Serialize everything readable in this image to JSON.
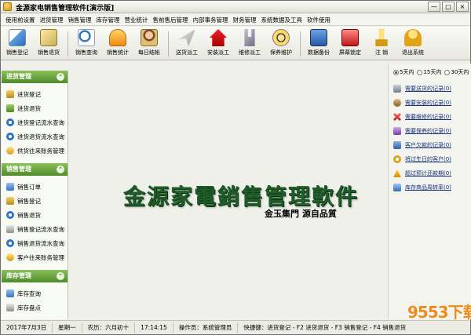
{
  "window": {
    "title": "金源家电销售管理软件[演示版]",
    "controls": [
      "—",
      "□",
      "×"
    ]
  },
  "menu": [
    "使用前设置",
    "进货管理",
    "销售管理",
    "库存管理",
    "营业统计",
    "售前售后管理",
    "内部事务管理",
    "财务管理",
    "系统数据及工具",
    "软件使用"
  ],
  "toolbar": [
    {
      "label": "销售登记",
      "icon": "register-icon"
    },
    {
      "label": "销售退货",
      "icon": "return-icon"
    },
    {
      "label": "销售查询",
      "icon": "query-icon"
    },
    {
      "label": "销售统计",
      "icon": "stats-icon"
    },
    {
      "label": "每日结帐",
      "icon": "daily-checkout-icon"
    },
    {
      "label": "送货派工",
      "icon": "dispatch-icon"
    },
    {
      "label": "安装派工",
      "icon": "install-icon"
    },
    {
      "label": "维修派工",
      "icon": "repair-icon"
    },
    {
      "label": "保养维护",
      "icon": "maintain-icon"
    },
    {
      "label": "数据备份",
      "icon": "backup-icon"
    },
    {
      "label": "屏幕锁定",
      "icon": "lock-icon"
    },
    {
      "label": "注 销",
      "icon": "logout-icon"
    },
    {
      "label": "退出系统",
      "icon": "exit-icon"
    }
  ],
  "sidebar": {
    "sections": [
      {
        "title": "进货管理",
        "items": [
          "进货登记",
          "进货退货",
          "进货登记流水查询",
          "进货退货流水查询",
          "供货往来账务管理"
        ]
      },
      {
        "title": "销售管理",
        "items": [
          "销售订单",
          "销售登记",
          "销售退货",
          "销售登记流水查询",
          "销售退货流水查询",
          "客户往来账务管理"
        ]
      },
      {
        "title": "库存管理",
        "items": [
          "库存查询",
          "库存盘点"
        ]
      }
    ]
  },
  "brand": {
    "logo_text": "金源家電銷售管理軟件",
    "slogan": "金玉集門  源自品質"
  },
  "reminders": {
    "range_options": [
      "5天内",
      "15天内",
      "30天内"
    ],
    "selected_range": "5天内",
    "items": [
      "需要送货的记录(0)",
      "需要安装的记录(0)",
      "需要维修的记录(0)",
      "需要保养的记录(0)",
      "客户欠款的记录(0)",
      "将过生日的客户(0)",
      "超过预计还款期(0)",
      "库存商品周转率(0)"
    ]
  },
  "status": {
    "date": "2017年7月3日",
    "weekday": "星期一",
    "lunar": "农历：六月初十",
    "time": "17:14:15",
    "operator": "操作员：系统管理员",
    "shortcuts": "快捷键：进货登记 - F2 进货退货 - F3 销售登记 - F4 销售退货"
  },
  "watermark": "9553下载"
}
